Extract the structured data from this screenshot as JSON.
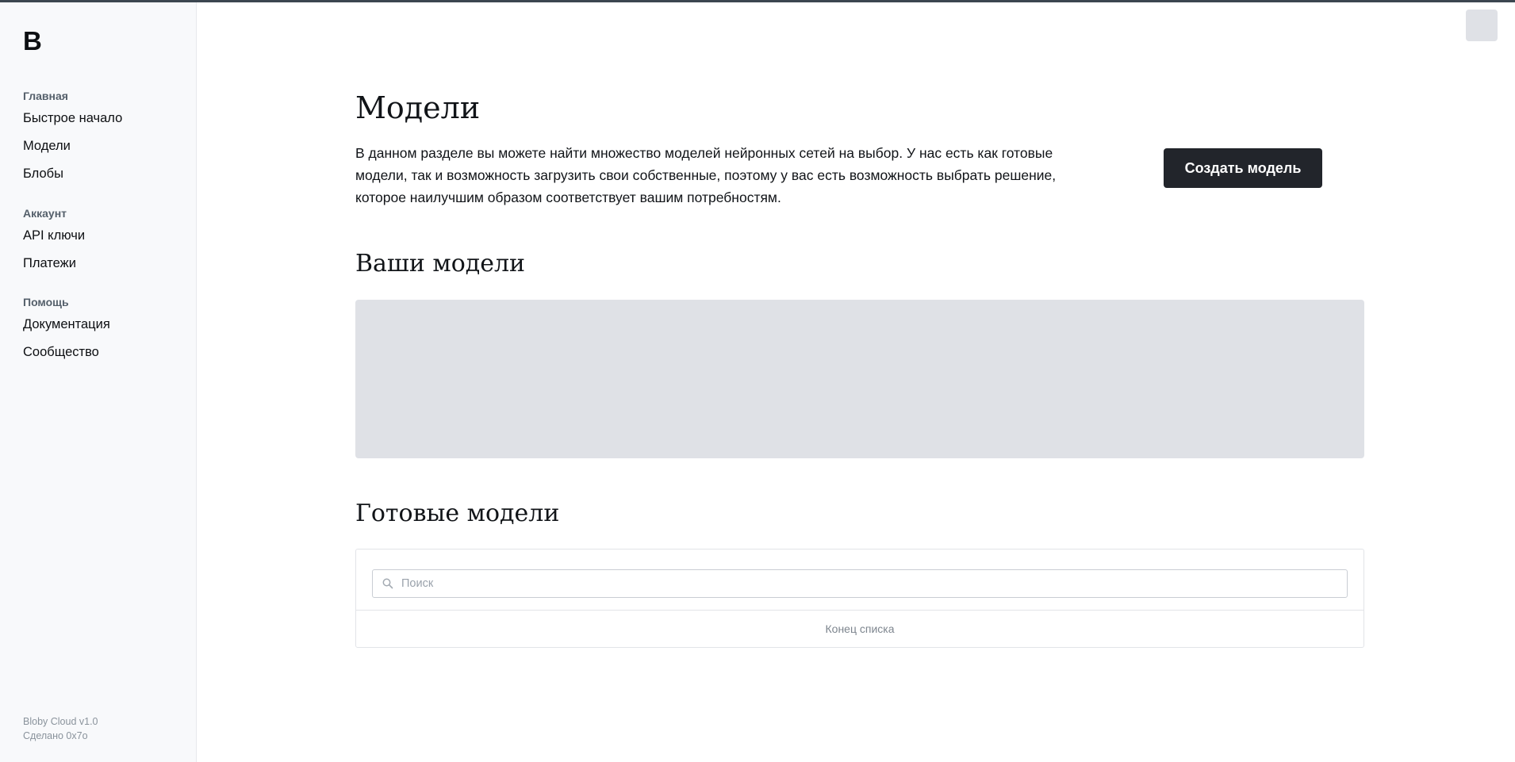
{
  "sidebar": {
    "logo": "B",
    "groups": [
      {
        "heading": "Главная",
        "items": [
          {
            "label": "Быстрое начало"
          },
          {
            "label": "Модели"
          },
          {
            "label": "Блобы"
          }
        ]
      },
      {
        "heading": "Аккаунт",
        "items": [
          {
            "label": "API ключи"
          },
          {
            "label": "Платежи"
          }
        ]
      },
      {
        "heading": "Помощь",
        "items": [
          {
            "label": "Документация"
          },
          {
            "label": "Сообщество"
          }
        ]
      }
    ],
    "footer": {
      "version": "Bloby Cloud v1.0",
      "made_by": "Сделано 0x7o"
    }
  },
  "main": {
    "title": "Модели",
    "intro": "В данном разделе вы можете найти множество моделей нейронных сетей на выбор. У нас есть как готовые модели, так и возможность загрузить свои собственные, поэтому у вас есть возможность выбрать решение, которое наилучшим образом соответствует вашим потребностям.",
    "create_button": "Создать модель",
    "your_models": {
      "title": "Ваши модели"
    },
    "ready_models": {
      "title": "Готовые модели",
      "search_placeholder": "Поиск",
      "search_value": "",
      "end_of_list": "Конец списка"
    }
  },
  "colors": {
    "primary_button": "#22252b",
    "sidebar_bg": "#f8f9fb",
    "skeleton": "#dfe1e6",
    "topbar": "#3c4650"
  }
}
